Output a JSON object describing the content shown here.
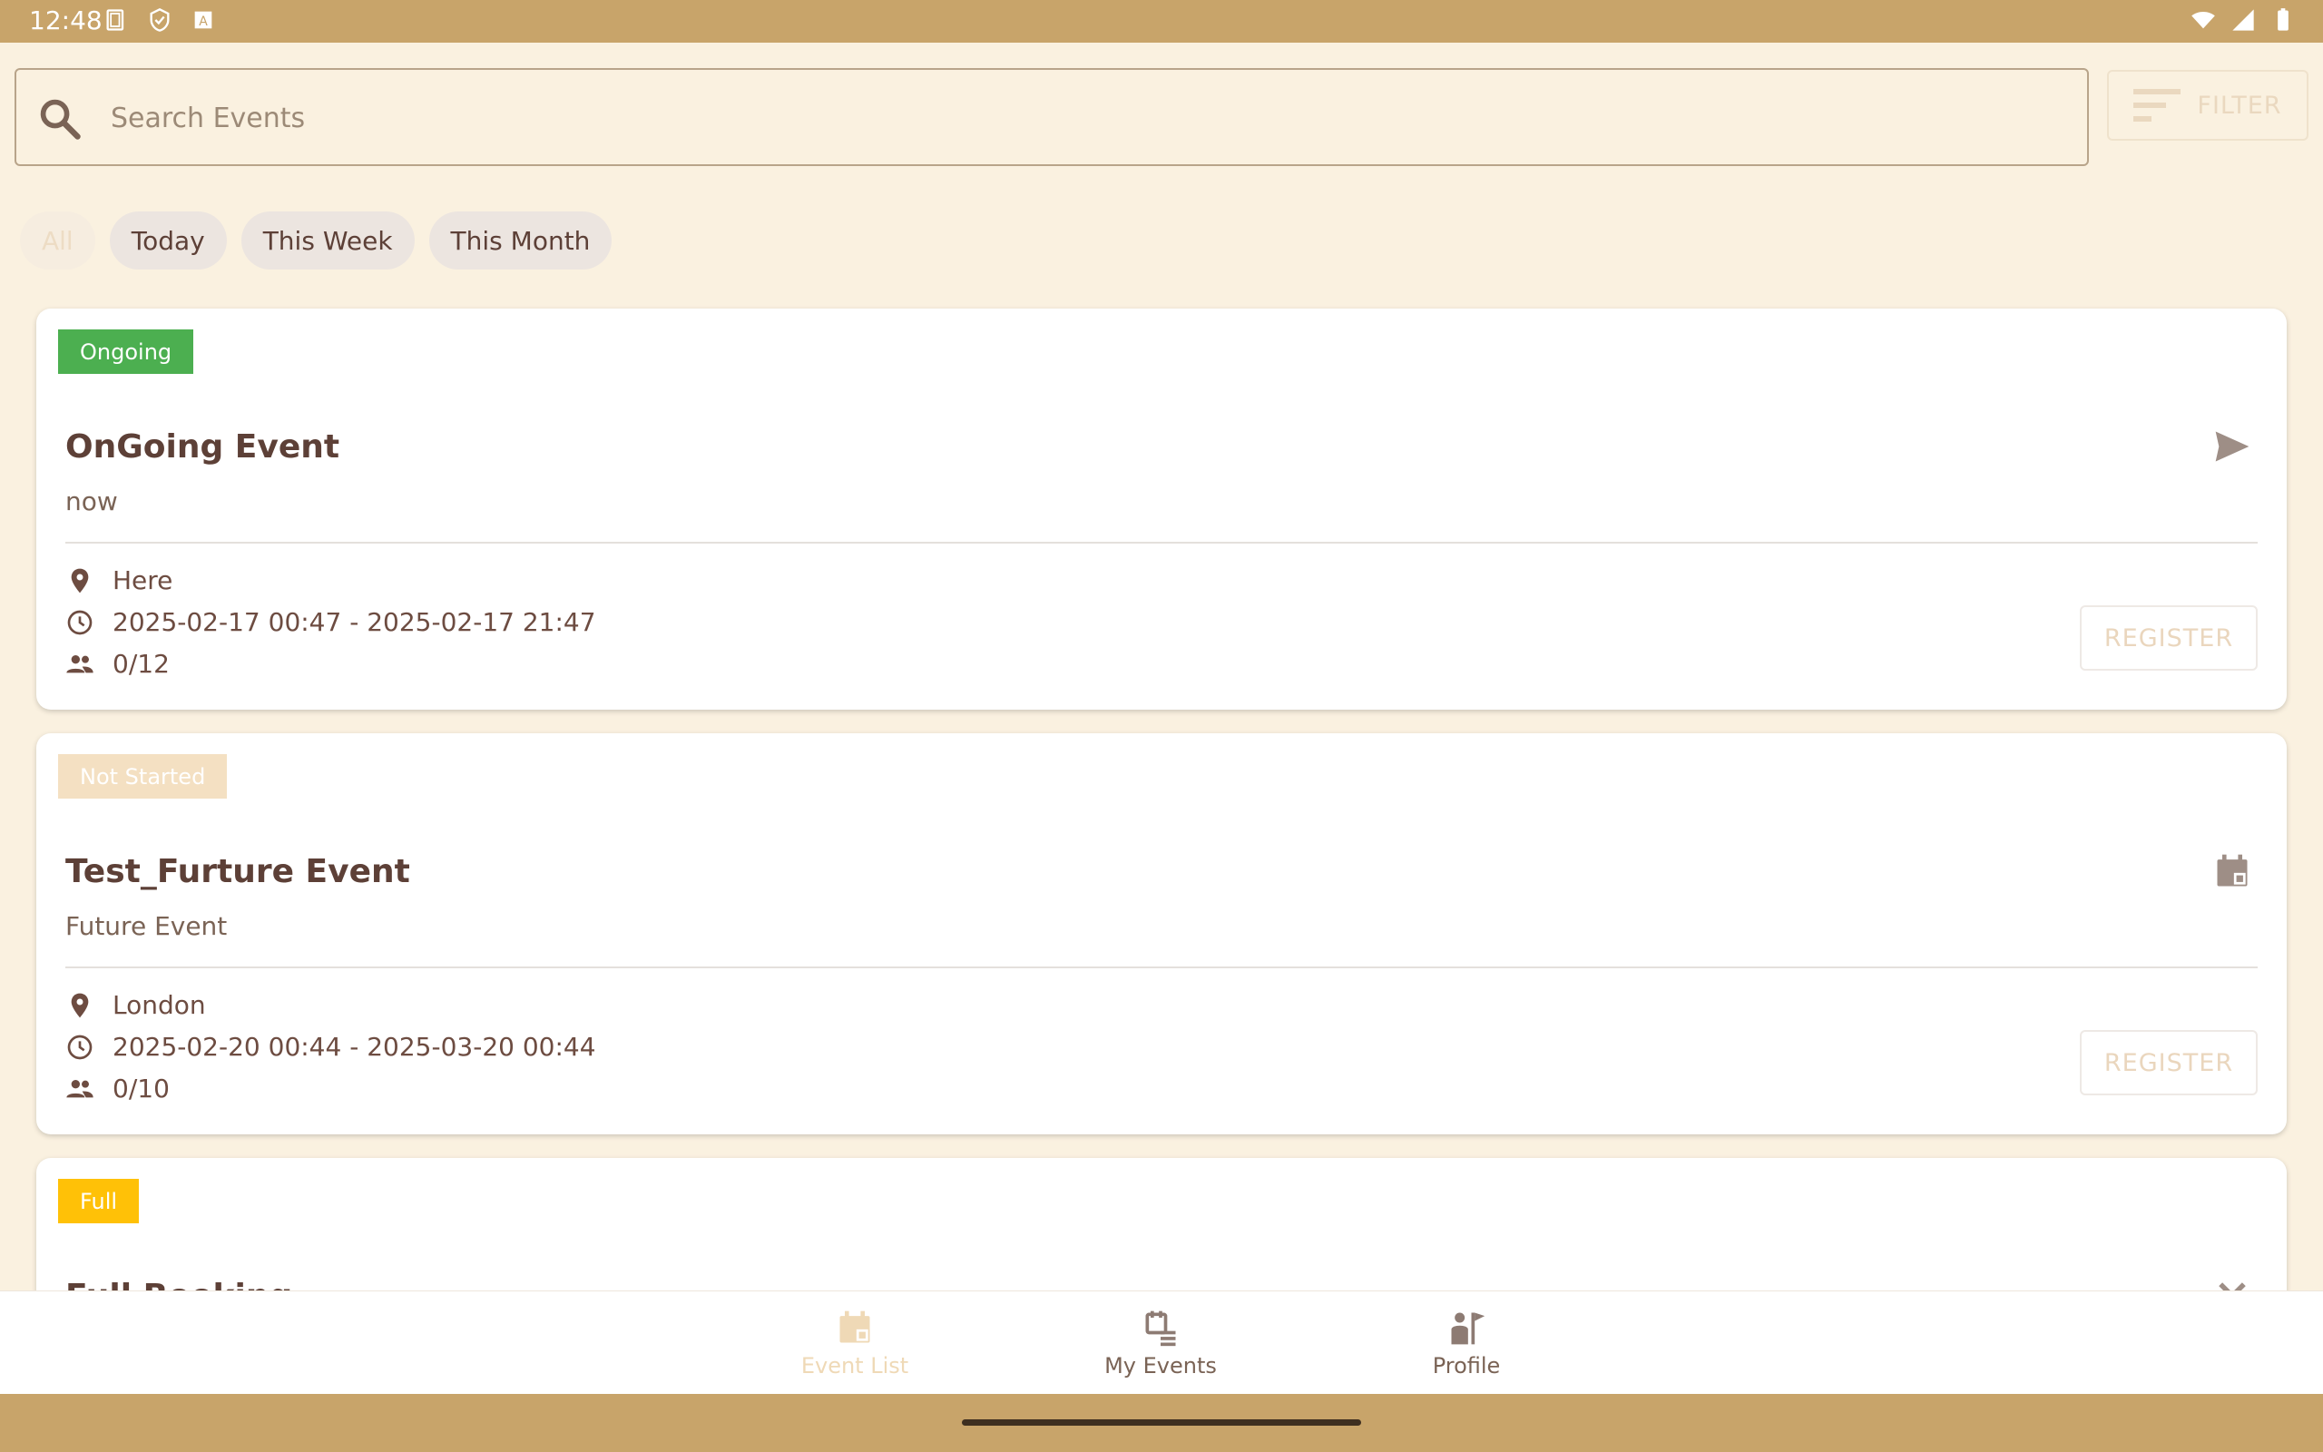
{
  "status_bar": {
    "time": "12:48",
    "left_icons": [
      "screenshot-icon",
      "shield-icon",
      "font-icon"
    ],
    "right_icons": [
      "wifi-icon",
      "signal-icon",
      "battery-icon"
    ]
  },
  "search": {
    "placeholder": "Search Events",
    "value": ""
  },
  "filter_button": {
    "label": "FILTER",
    "icon": "filter-list-icon"
  },
  "chips": [
    {
      "label": "All",
      "selected": true
    },
    {
      "label": "Today",
      "selected": false
    },
    {
      "label": "This Week",
      "selected": false
    },
    {
      "label": "This Month",
      "selected": false
    }
  ],
  "events": [
    {
      "badge": "Ongoing",
      "badge_color": "#4CAF50",
      "title": "OnGoing Event",
      "subtitle": "now",
      "location": "Here",
      "time": "2025-02-17 00:47 - 2025-02-17 21:47",
      "attendees": "0/12",
      "register_label": "REGISTER",
      "action_icon": "send-icon"
    },
    {
      "badge": "Not Started",
      "badge_color": "#F4E0C2",
      "title": "Test_Furture Event",
      "subtitle": "Future Event",
      "location": "London",
      "time": "2025-02-20 00:44 - 2025-03-20 00:44",
      "attendees": "0/10",
      "register_label": "REGISTER",
      "action_icon": "calendar-icon"
    },
    {
      "badge": "Full",
      "badge_color": "#FFC107",
      "title": "Full Booking",
      "action_icon": "close-icon"
    }
  ],
  "bottom_nav": [
    {
      "label": "Event List",
      "icon": "event-list-icon",
      "active": true
    },
    {
      "label": "My Events",
      "icon": "my-events-icon",
      "active": false
    },
    {
      "label": "Profile",
      "icon": "profile-icon",
      "active": false
    }
  ]
}
